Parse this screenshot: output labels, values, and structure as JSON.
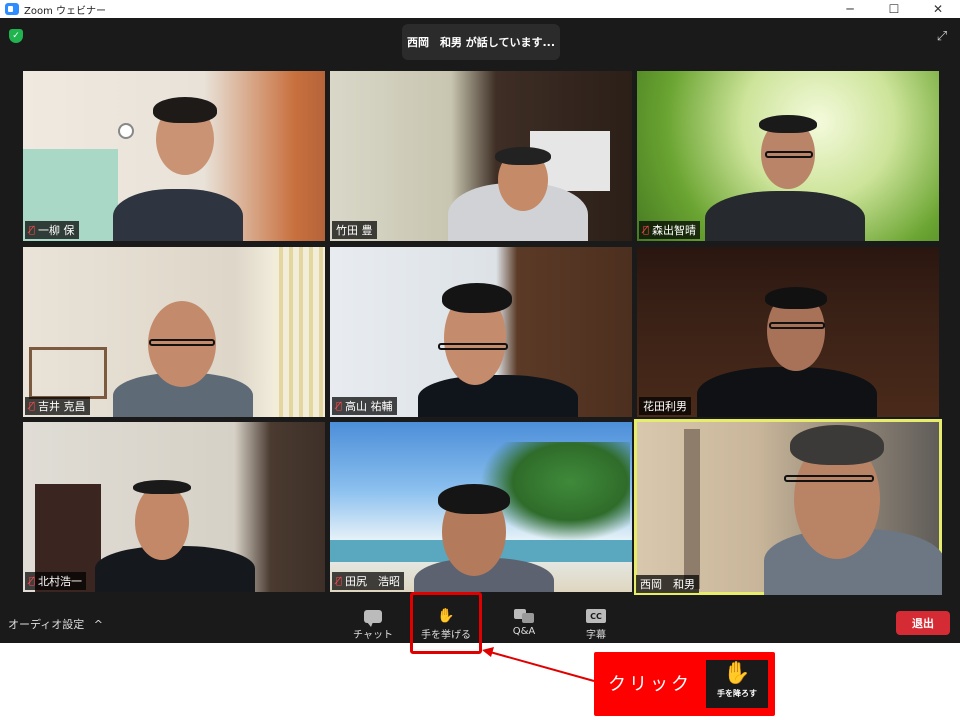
{
  "window": {
    "title": "Zoom ウェビナー",
    "minimize": "─",
    "maximize": "☐",
    "close": "✕"
  },
  "speaker_banner": "西岡　和男 が話しています...",
  "participants": [
    {
      "name": "一柳 保",
      "muted": true
    },
    {
      "name": "竹田 豊",
      "muted": false
    },
    {
      "name": "森出智晴",
      "muted": true
    },
    {
      "name": "吉井 克昌",
      "muted": true
    },
    {
      "name": "高山 祐輔",
      "muted": true
    },
    {
      "name": "花田利男",
      "muted": false
    },
    {
      "name": "北村浩一",
      "muted": true
    },
    {
      "name": "田尻　浩昭",
      "muted": true
    },
    {
      "name": "西岡　和男",
      "muted": false,
      "active_speaker": true
    }
  ],
  "toolbar": {
    "audio_settings": "オーディオ設定",
    "audio_caret": "^",
    "chat": "チャット",
    "raise_hand": "手を挙げる",
    "qa": "Q&A",
    "captions": "字幕",
    "cc_icon": "CC",
    "leave": "退出"
  },
  "annotation": {
    "text": "クリック",
    "lower_hand_label": "手を降ろす"
  },
  "colors": {
    "meeting_bg": "#1a1a1a",
    "leave": "#d52b34",
    "callout": "#ff0000",
    "active_border": "#e7ec6a",
    "hand_green": "#2bc440"
  }
}
